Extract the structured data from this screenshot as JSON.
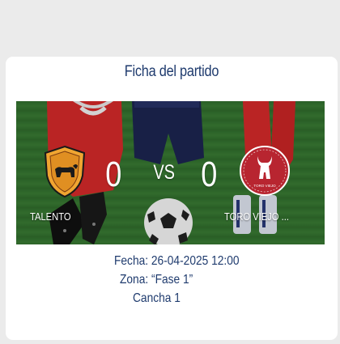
{
  "match": {
    "title": "Ficha del partido",
    "vs_label": "VS",
    "home": {
      "name": "TALENTO",
      "score": "0",
      "badge_icon": "bull-shield-icon",
      "badge_color": "#e79b2e"
    },
    "away": {
      "name": "TORO VIEJO ...",
      "score": "0",
      "badge_icon": "toro-viejo-logo-icon",
      "badge_color": "#b4232b",
      "badge_text": "TORO VIEJO"
    },
    "details": {
      "fecha": "Fecha: 26-04-2025 12:00",
      "zona": "Zona: “Fase 1”",
      "cancha": "Cancha 1"
    }
  },
  "colors": {
    "accent": "#1f3b6e",
    "background": "#ebebeb",
    "card": "#ffffff"
  }
}
